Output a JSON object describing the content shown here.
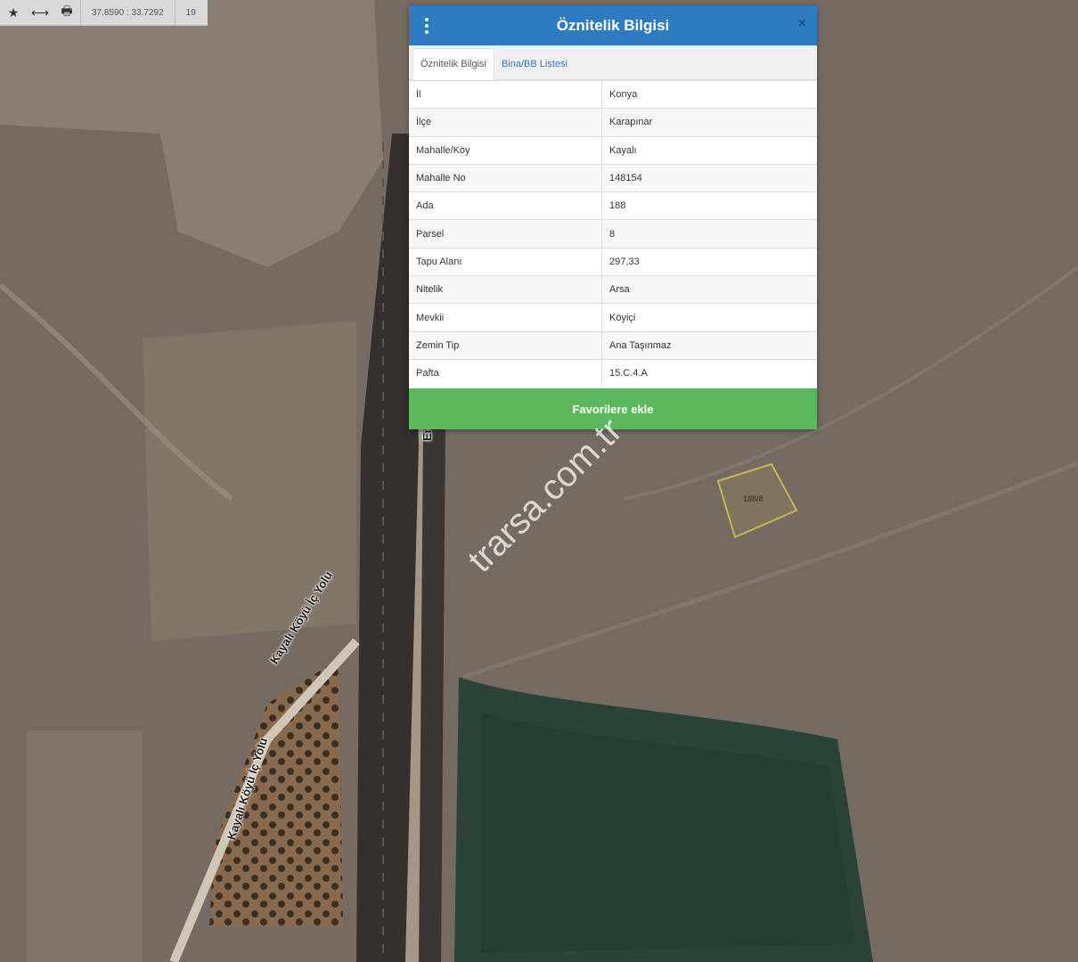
{
  "toolbar": {
    "star_icon": "star-icon",
    "measure_icon": "measure-icon",
    "print_icon": "print-icon",
    "coordinates": "37.8590 : 33.7292",
    "zoom": "19"
  },
  "map": {
    "road_labels": [
      "Kayalı Köyü İç Yolu",
      "Kayalı Köyü İç Yolu",
      "Er"
    ],
    "parcel_label": "188/8",
    "watermark": "trarsa.com.tr"
  },
  "panel": {
    "title": "Öznitelik Bilgisi",
    "tabs": [
      "Öznitelik Bilgisi",
      "Bina/BB Listesi"
    ],
    "rows": [
      {
        "key": "İl",
        "value": "Konya"
      },
      {
        "key": "İlçe",
        "value": "Karapınar"
      },
      {
        "key": "Mahalle/Köy",
        "value": "Kayalı"
      },
      {
        "key": "Mahalle No",
        "value": "148154"
      },
      {
        "key": "Ada",
        "value": "188"
      },
      {
        "key": "Parsel",
        "value": "8"
      },
      {
        "key": "Tapu Alanı",
        "value": "297,33"
      },
      {
        "key": "Nitelik",
        "value": "Arsa"
      },
      {
        "key": "Mevkii",
        "value": "Köyiçi"
      },
      {
        "key": "Zemin Tip",
        "value": "Ana Taşınmaz"
      },
      {
        "key": "Pafta",
        "value": "15.C.4.A"
      }
    ],
    "favorite_button": "Favorilere ekle",
    "close_symbol": "×"
  },
  "colors": {
    "header": "#2f7bbf",
    "button": "#5cb85c",
    "parcel_outline": "#c8b450"
  }
}
